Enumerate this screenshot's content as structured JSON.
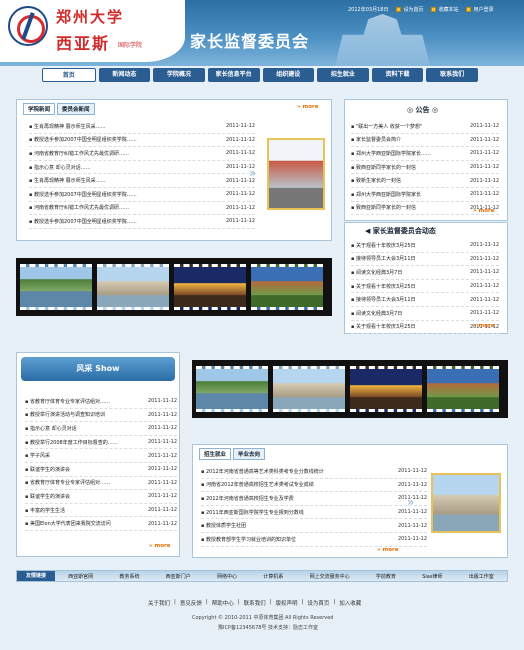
{
  "header": {
    "date": "2012年03月18日",
    "set_home": "设为首页",
    "bookmark": "收藏本站",
    "user_login": "用户登录",
    "school_line1": "郑州大学",
    "school_line2": "西亚斯",
    "school_line3": "国际学院",
    "site_title": "家长监督委员会"
  },
  "nav": [
    "首页",
    "新闻动态",
    "学院概况",
    "家长信息平台",
    "组织建设",
    "招生就业",
    "资料下载",
    "联系我们"
  ],
  "news_box": {
    "tabs": [
      "学院新闻",
      "委员会新闻"
    ],
    "more": "more",
    "items": [
      {
        "title": "生肖再现精神 展示师生风采……",
        "date": "2011-11-12"
      },
      {
        "title": "教授选手参加2007中国全明星组织奖学院……",
        "date": "2011-11-12"
      },
      {
        "title": "河南省教育厅纠错工作风尤先最优调研……",
        "date": "2011-11-12"
      },
      {
        "title": "指示心意 却心灵对话……",
        "date": "2011-11-12"
      },
      {
        "title": "生肖再现精神 展示师生风采……",
        "date": "2011-11-12"
      },
      {
        "title": "教授选手参加2007中国全明星组织奖学院……",
        "date": "2011-11-12"
      },
      {
        "title": "河南省教育厅纠错工作风尤先最优调研……",
        "date": "2011-11-12"
      },
      {
        "title": "教授选手参加2007中国全明星组织奖学院……",
        "date": "2011-11-12"
      }
    ]
  },
  "notice": {
    "title": "公告",
    "more": "more",
    "items": [
      {
        "title": "\"联出一方美人 收获一个梦想\"",
        "date": "2011-11-12"
      },
      {
        "title": "家长监督委员会简介",
        "date": "2011-11-12"
      },
      {
        "title": "郑州大学西亚斯国际学院家长……",
        "date": "2011-11-12"
      },
      {
        "title": "致西亚斯同学家长的一封信",
        "date": "2011-11-12"
      },
      {
        "title": "致新生家长的一封信",
        "date": "2011-11-12"
      },
      {
        "title": "郑州大学西亚斯国际学院家长",
        "date": "2011-11-12"
      },
      {
        "title": "致西亚斯同学家长的一封信",
        "date": "2011-11-12"
      }
    ]
  },
  "committee": {
    "title": "家长监督委员会动态",
    "more": "more",
    "items": [
      {
        "title": "关于观看十年校庆3月25日",
        "date": "2011-11-12"
      },
      {
        "title": "接待领导员工大会3月11日",
        "date": "2011-11-12"
      },
      {
        "title": "阅读文化经典3月7日",
        "date": "2011-11-12"
      },
      {
        "title": "关于观看十年校庆3月25日",
        "date": "2011-11-12"
      },
      {
        "title": "接待领导员工大会3月11日",
        "date": "2011-11-12"
      },
      {
        "title": "阅读文化经典3月7日",
        "date": "2011-11-12"
      },
      {
        "title": "关于观看十年校庆3月25日",
        "date": "2011-11-12"
      }
    ]
  },
  "show_box": {
    "title": "风采 Show",
    "more": "more",
    "items": [
      {
        "title": "省教育厅体育专业专家评估组对……",
        "date": "2011-11-12"
      },
      {
        "title": "教授举行演讲活动与调查知识培训",
        "date": "2011-11-12"
      },
      {
        "title": "指示心意 却心灵对话",
        "date": "2011-11-12"
      },
      {
        "title": "教授举行2008年度工作目标督查的……",
        "date": "2011-11-12"
      },
      {
        "title": "学子风采",
        "date": "2011-11-12"
      },
      {
        "title": "联谊学生的演讲会",
        "date": "2011-11-12"
      },
      {
        "title": "省教育厅体育专业专家评估组对……",
        "date": "2011-11-12"
      },
      {
        "title": "联谊学生的演讲会",
        "date": "2011-11-12"
      },
      {
        "title": "丰富的学生生活",
        "date": "2011-11-12"
      },
      {
        "title": "美国Elon大学代表团来我院交流访问",
        "date": "2011-11-12"
      }
    ]
  },
  "job_box": {
    "tabs": [
      "招生就业",
      "毕业去向"
    ],
    "more": "more",
    "items": [
      {
        "title": "2012年河南省普通高等艺术类科类考专业分数线统计",
        "date": "2011-11-12"
      },
      {
        "title": "河南省2012年普通高校招生艺术类考试专业成绩",
        "date": "2011-11-12"
      },
      {
        "title": "2012年河南省普通高校招生专业及学费",
        "date": "2011-11-12"
      },
      {
        "title": "2011年西亚斯国际学院学生专业报到分数线",
        "date": "2011-11-12"
      },
      {
        "title": "教授体质学生社团",
        "date": "2011-11-12"
      },
      {
        "title": "教授教育部学生学习就业培训的知识单位",
        "date": "2011-11-12"
      }
    ]
  },
  "links": {
    "label": "友情链接",
    "items": [
      "西亚斯官网",
      "教务系统",
      "西亚斯门户",
      "网络中心",
      "计算机系",
      "网上交流服务中心",
      "学前教育",
      "Sias律师",
      "出版工作室"
    ]
  },
  "footer": {
    "links": [
      "关于我们",
      "意见反馈",
      "帮助中心",
      "联系我们",
      "版权声明",
      "设为首页",
      "加入收藏"
    ],
    "copyright": "Copyright © 2010-2011 中原体育集团 All Rights Reserved",
    "icp": "豫ICP备12345678号 技术支持：励志工作室"
  }
}
